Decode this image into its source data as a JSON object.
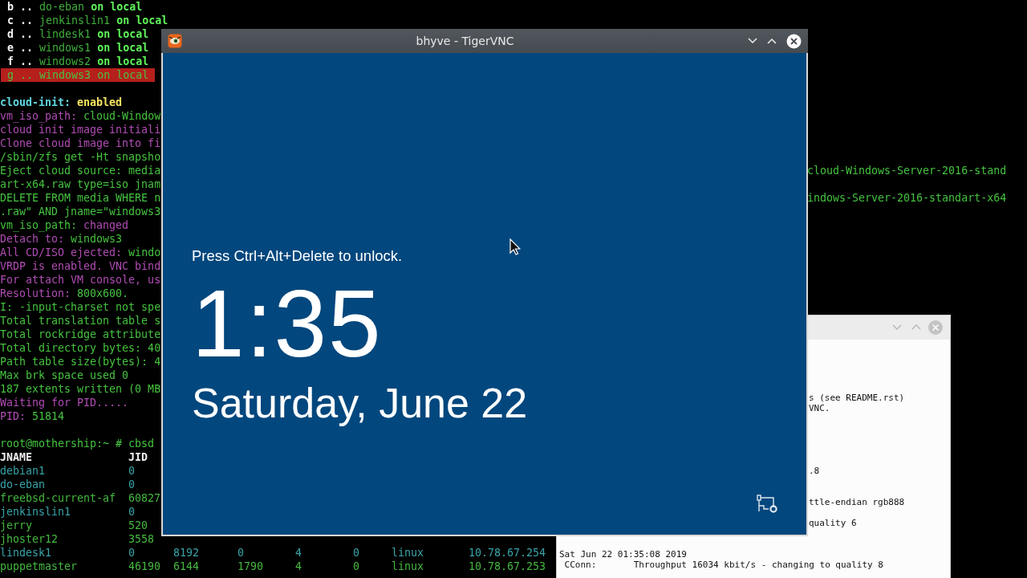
{
  "terminal": {
    "menu": [
      {
        "key": "b",
        "separator": "..",
        "name": "do-eban",
        "location": "on local",
        "selected": false
      },
      {
        "key": "c",
        "separator": "..",
        "name": "jenkinslin1",
        "location": "on local",
        "selected": false
      },
      {
        "key": "d",
        "separator": "..",
        "name": "lindesk1",
        "location": "on local",
        "selected": false
      },
      {
        "key": "e",
        "separator": "..",
        "name": "windows1",
        "location": "on local",
        "selected": false
      },
      {
        "key": "f",
        "separator": "..",
        "name": "windows2",
        "location": "on local",
        "selected": false
      },
      {
        "key": "g",
        "separator": "..",
        "name": "windows3",
        "location": "on local",
        "selected": true
      }
    ],
    "log_lines": [
      {
        "segments": [
          {
            "text": "cloud-init:",
            "color": "#5fd7e0"
          },
          {
            "text": " enabled",
            "color": "#f5e35f"
          }
        ]
      },
      {
        "segments": [
          {
            "text": "vm_iso_path:",
            "color": "#b04cb4"
          },
          {
            "text": " cloud-Window",
            "color": "#45c23f"
          }
        ]
      },
      {
        "segments": [
          {
            "text": "cloud init image initiali",
            "color": "#b04cb4"
          }
        ]
      },
      {
        "segments": [
          {
            "text": "Clone cloud image into fi",
            "color": "#b04cb4"
          }
        ]
      },
      {
        "segments": [
          {
            "text": "/sbin/zfs get -Ht snapsho",
            "color": "#45c23f"
          }
        ]
      },
      {
        "segments": [
          {
            "text": "Eject cloud source: media",
            "color": "#45c23f"
          }
        ],
        "right": {
          "text": "cloud-Windows-Server-2016-stand",
          "color": "#45c23f"
        }
      },
      {
        "segments": [
          {
            "text": "art-x64.raw type=iso jnam",
            "color": "#45c23f"
          }
        ]
      },
      {
        "segments": [
          {
            "text": "DELETE FROM media WHERE n",
            "color": "#45c23f"
          }
        ],
        "right": {
          "text": "indows-Server-2016-standart-x64",
          "color": "#45c23f"
        }
      },
      {
        "segments": [
          {
            "text": ".raw\" AND jname=\"windows3",
            "color": "#45c23f"
          }
        ]
      },
      {
        "segments": [
          {
            "text": "vm_iso_path:",
            "color": "#45c23f"
          },
          {
            "text": " changed",
            "color": "#b04cb4"
          }
        ]
      },
      {
        "segments": [
          {
            "text": "Detach to:",
            "color": "#b04cb4"
          },
          {
            "text": " windows3",
            "color": "#45c23f"
          }
        ]
      },
      {
        "segments": [
          {
            "text": "All CD/ISO ejected:",
            "color": "#b04cb4"
          },
          {
            "text": " windo",
            "color": "#45c23f"
          }
        ]
      },
      {
        "segments": [
          {
            "text": "VRDP is enabled. VNC bind",
            "color": "#b04cb4"
          }
        ]
      },
      {
        "segments": [
          {
            "text": "For attach VM console, us",
            "color": "#b04cb4"
          }
        ]
      },
      {
        "segments": [
          {
            "text": "Resolution:",
            "color": "#b04cb4"
          },
          {
            "text": " 800x600.",
            "color": "#45c23f"
          }
        ]
      },
      {
        "segments": [
          {
            "text": "I: -input-charset not spe",
            "color": "#45c23f"
          }
        ]
      },
      {
        "segments": [
          {
            "text": "Total translation table s",
            "color": "#45c23f"
          }
        ]
      },
      {
        "segments": [
          {
            "text": "Total rockridge attribute",
            "color": "#45c23f"
          }
        ]
      },
      {
        "segments": [
          {
            "text": "Total directory bytes: 40",
            "color": "#45c23f"
          }
        ]
      },
      {
        "segments": [
          {
            "text": "Path table size(bytes): 4",
            "color": "#45c23f"
          }
        ]
      },
      {
        "segments": [
          {
            "text": "Max brk space used 0",
            "color": "#45c23f"
          }
        ]
      },
      {
        "segments": [
          {
            "text": "187 extents written (0 MB",
            "color": "#45c23f"
          }
        ]
      },
      {
        "segments": [
          {
            "text": "Waiting for PID.....",
            "color": "#b04cb4"
          }
        ]
      },
      {
        "segments": [
          {
            "text": "PID:",
            "color": "#b04cb4"
          },
          {
            "text": " 51814",
            "color": "#45c23f"
          }
        ]
      }
    ],
    "prompt": "root@mothership:~ # cbsd",
    "table": {
      "columns": [
        "JNAME",
        "JID"
      ],
      "rows": [
        {
          "cells": [
            "debian1",
            "0"
          ],
          "color": "#38a3a8"
        },
        {
          "cells": [
            "do-eban",
            "0"
          ],
          "color": "#38a3a8"
        },
        {
          "cells": [
            "freebsd-current-af",
            "60827"
          ],
          "color": "#45b83f"
        },
        {
          "cells": [
            "jenkinslin1",
            "0"
          ],
          "color": "#38a3a8"
        },
        {
          "cells": [
            "jerry",
            "520"
          ],
          "color": "#45b83f"
        },
        {
          "cells": [
            "jhoster12",
            "3558"
          ],
          "color": "#45b83f"
        },
        {
          "cells": [
            "lindesk1",
            "0",
            "8192",
            "0",
            "4",
            "0",
            "linux",
            "10.78.67.254"
          ],
          "color": "#38a3a8"
        },
        {
          "cells": [
            "puppetmaster",
            "46190",
            "6144",
            "1790",
            "4",
            "0",
            "linux",
            "10.78.67.253"
          ],
          "color": "#45b83f"
        }
      ]
    }
  },
  "vnc_window": {
    "title": "bhyve - TigerVNC",
    "lock_screen": {
      "hint": "Press Ctrl+Alt+Delete to unlock.",
      "time": "1:35",
      "date": "Saturday, June 22"
    }
  },
  "log_window": {
    "lines": [
      {
        "text": "s (see README.rst)",
        "kind": "clipped"
      },
      {
        "text": "VNC.",
        "kind": "clipped"
      },
      {
        "text": ".8",
        "kind": "clipped"
      },
      {
        "text": "ttle-endian rgb888",
        "kind": "clipped"
      },
      {
        "text": "quality 6",
        "kind": "clipped"
      },
      {
        "text": "Sat Jun 22 01:35:08 2019",
        "kind": "full"
      },
      {
        "text": " CConn:       Throughput 16034 kbit/s - changing to quality 8",
        "kind": "full"
      }
    ]
  }
}
